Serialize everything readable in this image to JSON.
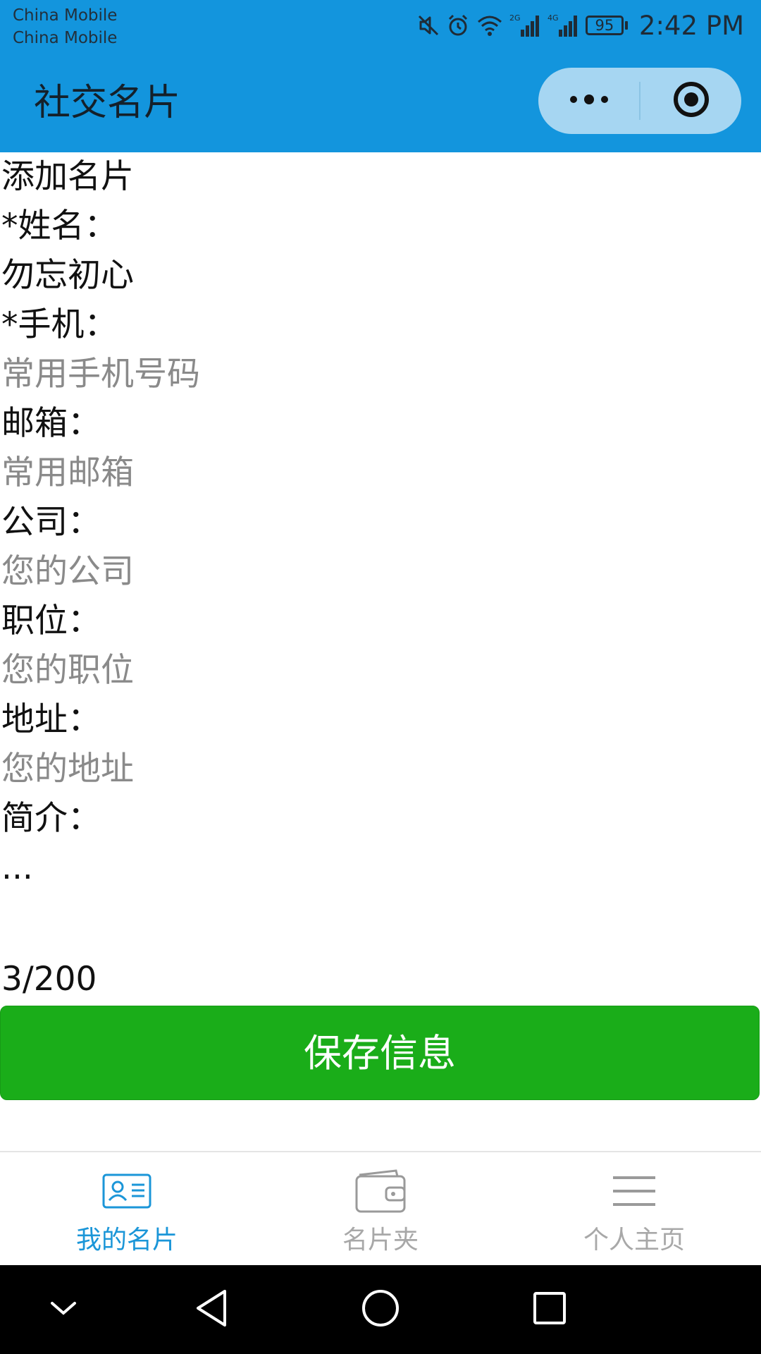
{
  "status_bar": {
    "carrier_1": "China Mobile",
    "carrier_2": "China Mobile",
    "network_1": "2G",
    "network_2": "4G",
    "battery": "95",
    "time": "2:42 PM",
    "icons": [
      "mute-icon",
      "alarm-icon",
      "wifi-icon",
      "signal-icon",
      "signal-icon",
      "battery-icon"
    ]
  },
  "nav_bar": {
    "title": "社交名片",
    "background_color": "#1395dd",
    "more_icon": "more-dots-icon",
    "close_icon": "target-close-icon"
  },
  "form": {
    "heading": "添加名片",
    "fields": {
      "name": {
        "label": "*姓名：",
        "value": "勿忘初心",
        "placeholder": ""
      },
      "phone": {
        "label": "*手机：",
        "value": "",
        "placeholder": "常用手机号码"
      },
      "email": {
        "label": "邮箱：",
        "value": "",
        "placeholder": "常用邮箱"
      },
      "company": {
        "label": "公司：",
        "value": "",
        "placeholder": "您的公司"
      },
      "position": {
        "label": "职位：",
        "value": "",
        "placeholder": "您的职位"
      },
      "address": {
        "label": "地址：",
        "value": "",
        "placeholder": "您的地址"
      },
      "intro": {
        "label": "简介：",
        "value": "..."
      }
    },
    "counter": "3/200",
    "save_button": "保存信息",
    "save_button_color": "#1aad19"
  },
  "tab_bar": {
    "tabs": [
      {
        "label": "我的名片",
        "icon": "business-card-icon",
        "active": true
      },
      {
        "label": "名片夹",
        "icon": "wallet-icon",
        "active": false
      },
      {
        "label": "个人主页",
        "icon": "menu-lines-icon",
        "active": false
      }
    ],
    "active_color": "#1b96d8",
    "inactive_color": "#a8a8a8"
  },
  "system_nav": {
    "buttons": [
      "collapse-chevron-icon",
      "back-triangle-icon",
      "home-circle-icon",
      "recents-square-icon"
    ]
  }
}
